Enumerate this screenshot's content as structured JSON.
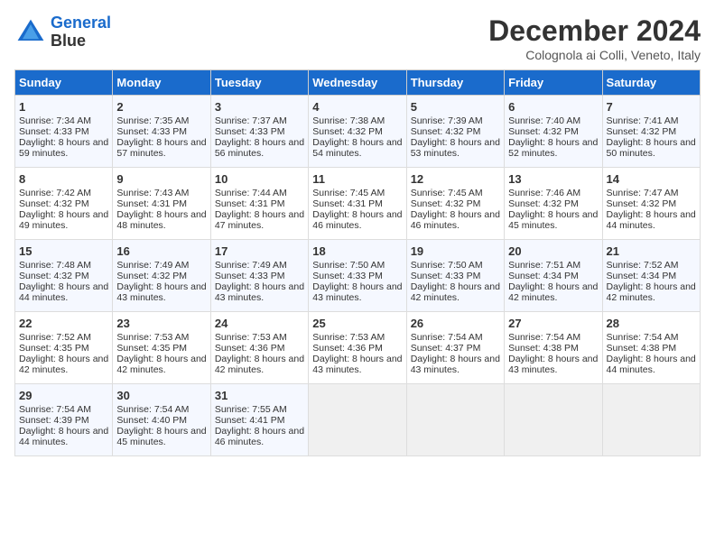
{
  "logo": {
    "line1": "General",
    "line2": "Blue"
  },
  "title": "December 2024",
  "subtitle": "Colognola ai Colli, Veneto, Italy",
  "days_of_week": [
    "Sunday",
    "Monday",
    "Tuesday",
    "Wednesday",
    "Thursday",
    "Friday",
    "Saturday"
  ],
  "weeks": [
    [
      {
        "day": "1",
        "sunrise": "Sunrise: 7:34 AM",
        "sunset": "Sunset: 4:33 PM",
        "daylight": "Daylight: 8 hours and 59 minutes."
      },
      {
        "day": "2",
        "sunrise": "Sunrise: 7:35 AM",
        "sunset": "Sunset: 4:33 PM",
        "daylight": "Daylight: 8 hours and 57 minutes."
      },
      {
        "day": "3",
        "sunrise": "Sunrise: 7:37 AM",
        "sunset": "Sunset: 4:33 PM",
        "daylight": "Daylight: 8 hours and 56 minutes."
      },
      {
        "day": "4",
        "sunrise": "Sunrise: 7:38 AM",
        "sunset": "Sunset: 4:32 PM",
        "daylight": "Daylight: 8 hours and 54 minutes."
      },
      {
        "day": "5",
        "sunrise": "Sunrise: 7:39 AM",
        "sunset": "Sunset: 4:32 PM",
        "daylight": "Daylight: 8 hours and 53 minutes."
      },
      {
        "day": "6",
        "sunrise": "Sunrise: 7:40 AM",
        "sunset": "Sunset: 4:32 PM",
        "daylight": "Daylight: 8 hours and 52 minutes."
      },
      {
        "day": "7",
        "sunrise": "Sunrise: 7:41 AM",
        "sunset": "Sunset: 4:32 PM",
        "daylight": "Daylight: 8 hours and 50 minutes."
      }
    ],
    [
      {
        "day": "8",
        "sunrise": "Sunrise: 7:42 AM",
        "sunset": "Sunset: 4:32 PM",
        "daylight": "Daylight: 8 hours and 49 minutes."
      },
      {
        "day": "9",
        "sunrise": "Sunrise: 7:43 AM",
        "sunset": "Sunset: 4:31 PM",
        "daylight": "Daylight: 8 hours and 48 minutes."
      },
      {
        "day": "10",
        "sunrise": "Sunrise: 7:44 AM",
        "sunset": "Sunset: 4:31 PM",
        "daylight": "Daylight: 8 hours and 47 minutes."
      },
      {
        "day": "11",
        "sunrise": "Sunrise: 7:45 AM",
        "sunset": "Sunset: 4:31 PM",
        "daylight": "Daylight: 8 hours and 46 minutes."
      },
      {
        "day": "12",
        "sunrise": "Sunrise: 7:45 AM",
        "sunset": "Sunset: 4:32 PM",
        "daylight": "Daylight: 8 hours and 46 minutes."
      },
      {
        "day": "13",
        "sunrise": "Sunrise: 7:46 AM",
        "sunset": "Sunset: 4:32 PM",
        "daylight": "Daylight: 8 hours and 45 minutes."
      },
      {
        "day": "14",
        "sunrise": "Sunrise: 7:47 AM",
        "sunset": "Sunset: 4:32 PM",
        "daylight": "Daylight: 8 hours and 44 minutes."
      }
    ],
    [
      {
        "day": "15",
        "sunrise": "Sunrise: 7:48 AM",
        "sunset": "Sunset: 4:32 PM",
        "daylight": "Daylight: 8 hours and 44 minutes."
      },
      {
        "day": "16",
        "sunrise": "Sunrise: 7:49 AM",
        "sunset": "Sunset: 4:32 PM",
        "daylight": "Daylight: 8 hours and 43 minutes."
      },
      {
        "day": "17",
        "sunrise": "Sunrise: 7:49 AM",
        "sunset": "Sunset: 4:33 PM",
        "daylight": "Daylight: 8 hours and 43 minutes."
      },
      {
        "day": "18",
        "sunrise": "Sunrise: 7:50 AM",
        "sunset": "Sunset: 4:33 PM",
        "daylight": "Daylight: 8 hours and 43 minutes."
      },
      {
        "day": "19",
        "sunrise": "Sunrise: 7:50 AM",
        "sunset": "Sunset: 4:33 PM",
        "daylight": "Daylight: 8 hours and 42 minutes."
      },
      {
        "day": "20",
        "sunrise": "Sunrise: 7:51 AM",
        "sunset": "Sunset: 4:34 PM",
        "daylight": "Daylight: 8 hours and 42 minutes."
      },
      {
        "day": "21",
        "sunrise": "Sunrise: 7:52 AM",
        "sunset": "Sunset: 4:34 PM",
        "daylight": "Daylight: 8 hours and 42 minutes."
      }
    ],
    [
      {
        "day": "22",
        "sunrise": "Sunrise: 7:52 AM",
        "sunset": "Sunset: 4:35 PM",
        "daylight": "Daylight: 8 hours and 42 minutes."
      },
      {
        "day": "23",
        "sunrise": "Sunrise: 7:53 AM",
        "sunset": "Sunset: 4:35 PM",
        "daylight": "Daylight: 8 hours and 42 minutes."
      },
      {
        "day": "24",
        "sunrise": "Sunrise: 7:53 AM",
        "sunset": "Sunset: 4:36 PM",
        "daylight": "Daylight: 8 hours and 42 minutes."
      },
      {
        "day": "25",
        "sunrise": "Sunrise: 7:53 AM",
        "sunset": "Sunset: 4:36 PM",
        "daylight": "Daylight: 8 hours and 43 minutes."
      },
      {
        "day": "26",
        "sunrise": "Sunrise: 7:54 AM",
        "sunset": "Sunset: 4:37 PM",
        "daylight": "Daylight: 8 hours and 43 minutes."
      },
      {
        "day": "27",
        "sunrise": "Sunrise: 7:54 AM",
        "sunset": "Sunset: 4:38 PM",
        "daylight": "Daylight: 8 hours and 43 minutes."
      },
      {
        "day": "28",
        "sunrise": "Sunrise: 7:54 AM",
        "sunset": "Sunset: 4:38 PM",
        "daylight": "Daylight: 8 hours and 44 minutes."
      }
    ],
    [
      {
        "day": "29",
        "sunrise": "Sunrise: 7:54 AM",
        "sunset": "Sunset: 4:39 PM",
        "daylight": "Daylight: 8 hours and 44 minutes."
      },
      {
        "day": "30",
        "sunrise": "Sunrise: 7:54 AM",
        "sunset": "Sunset: 4:40 PM",
        "daylight": "Daylight: 8 hours and 45 minutes."
      },
      {
        "day": "31",
        "sunrise": "Sunrise: 7:55 AM",
        "sunset": "Sunset: 4:41 PM",
        "daylight": "Daylight: 8 hours and 46 minutes."
      },
      null,
      null,
      null,
      null
    ]
  ]
}
